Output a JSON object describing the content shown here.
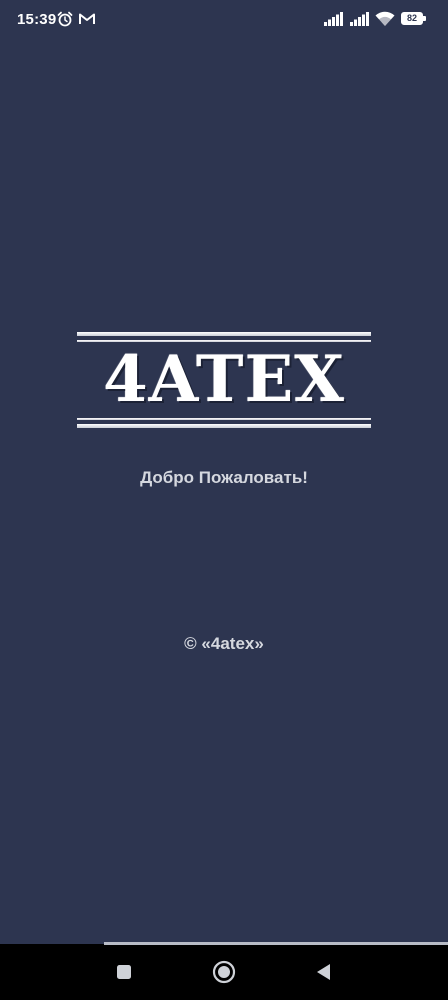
{
  "status_bar": {
    "time": "15:39",
    "alarm_icon": "alarm-clock-icon",
    "mail_icon": "gmail-icon",
    "signal_icons": [
      "cell-signal-icon",
      "cell-signal-icon"
    ],
    "wifi_icon": "wifi-icon",
    "battery_level": "82"
  },
  "splash": {
    "logo_text": "4ATEX",
    "welcome_text": "Добро Пожаловать!",
    "copyright_text": "© «4atex»"
  },
  "navigation": {
    "recents_icon": "square-recents-icon",
    "home_icon": "circle-home-icon",
    "back_icon": "triangle-back-icon"
  },
  "colors": {
    "background": "#2d3550",
    "text": "#d5d8df",
    "navbar": "#000000"
  }
}
